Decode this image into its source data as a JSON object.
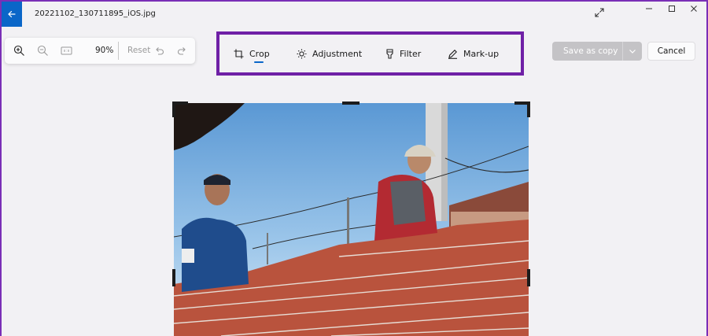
{
  "window": {
    "title": "20221102_130711895_iOS.jpg"
  },
  "zoom_toolbar": {
    "zoom_level": "90%",
    "reset_label": "Reset",
    "icons": [
      "zoom-in-icon",
      "zoom-out-icon",
      "actual-size-icon",
      "undo-icon",
      "redo-icon"
    ]
  },
  "edit_tabs": [
    {
      "label": "Crop",
      "icon": "crop-icon",
      "selected": true
    },
    {
      "label": "Adjustment",
      "icon": "brightness-icon",
      "selected": false
    },
    {
      "label": "Filter",
      "icon": "filter-icon",
      "selected": false
    },
    {
      "label": "Mark-up",
      "icon": "pen-icon",
      "selected": false
    }
  ],
  "actions": {
    "save_label": "Save as copy",
    "cancel_label": "Cancel"
  },
  "colors": {
    "accent": "#0a66c8",
    "highlight_border": "#6f20a6",
    "save_button_disabled": "#c4c3c6"
  }
}
